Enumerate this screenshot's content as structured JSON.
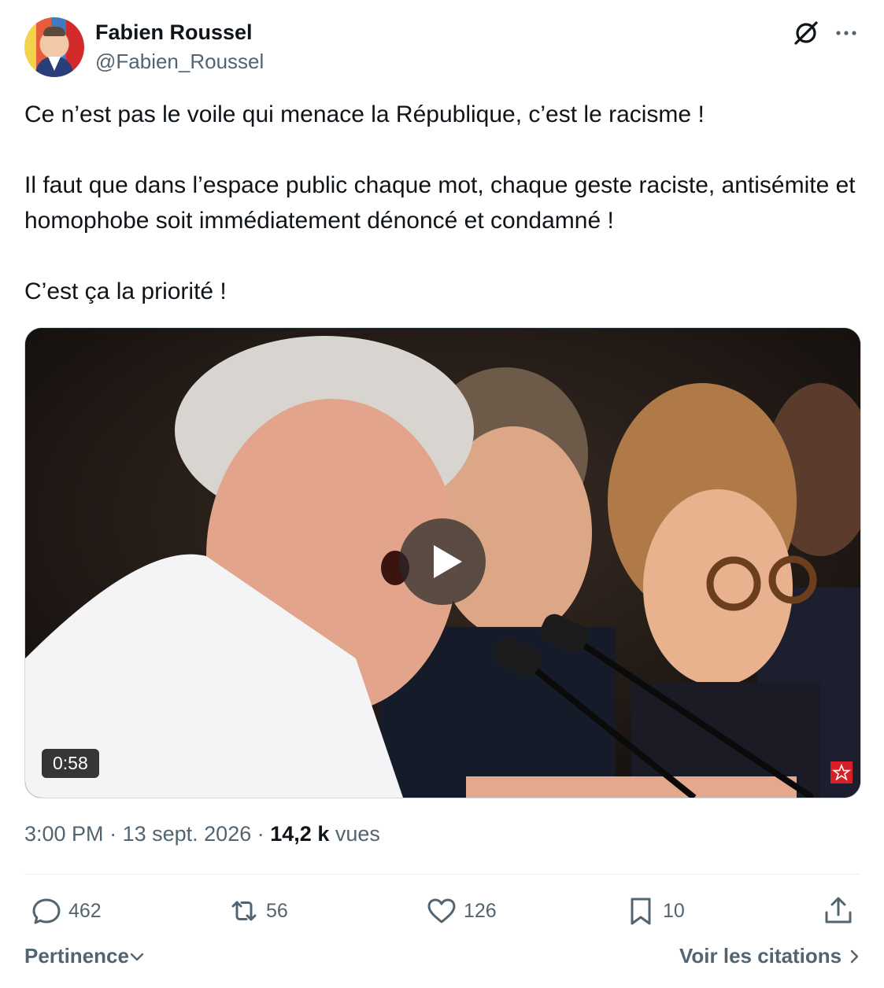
{
  "author": {
    "name": "Fabien Roussel",
    "handle": "@Fabien_Roussel"
  },
  "tweet": {
    "paragraphs": [
      "Ce n’est pas le voile qui menace la République, c’est le racisme !",
      "Il faut que dans l’espace public chaque mot, chaque geste raciste, antisémite et homophobe soit immédiatement dénoncé et condamné !",
      "C’est ça la priorité !"
    ]
  },
  "video": {
    "duration": "0:58"
  },
  "meta": {
    "time": "3:00 PM",
    "date": "13 sept. 2026",
    "views_count": "14,2 k",
    "views_label": "vues",
    "separator": "·"
  },
  "actions": {
    "replies": "462",
    "reposts": "56",
    "likes": "126",
    "bookmarks": "10"
  },
  "footer": {
    "sort_label": "Pertinence",
    "quotes_label": "Voir les citations"
  },
  "colors": {
    "text": "#0f1419",
    "secondary": "#536471",
    "divider": "#eff3f4"
  }
}
